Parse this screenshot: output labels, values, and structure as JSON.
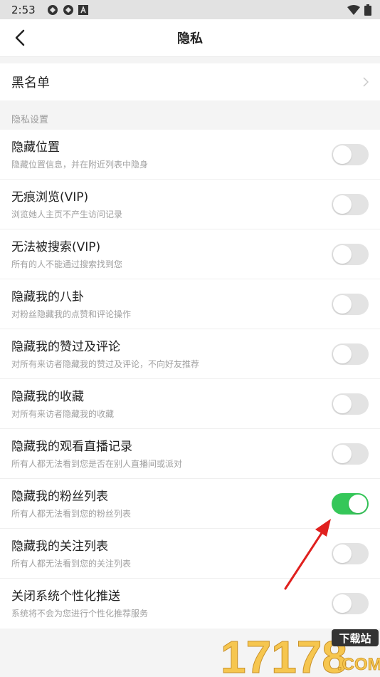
{
  "status": {
    "time": "2:53"
  },
  "nav": {
    "title": "隐私"
  },
  "blacklist": {
    "label": "黑名单"
  },
  "section": {
    "title": "隐私设置"
  },
  "items": [
    {
      "title": "隐藏位置",
      "subtitle": "隐藏位置信息，并在附近列表中隐身",
      "on": false
    },
    {
      "title": "无痕浏览(VIP)",
      "subtitle": "浏览她人主页不产生访问记录",
      "on": false
    },
    {
      "title": "无法被搜索(VIP)",
      "subtitle": "所有的人不能通过搜索找到您",
      "on": false
    },
    {
      "title": "隐藏我的八卦",
      "subtitle": "对粉丝隐藏我的点赞和评论操作",
      "on": false
    },
    {
      "title": "隐藏我的赞过及评论",
      "subtitle": "对所有来访者隐藏我的赞过及评论，不向好友推荐",
      "on": false
    },
    {
      "title": "隐藏我的收藏",
      "subtitle": "对所有来访者隐藏我的收藏",
      "on": false
    },
    {
      "title": "隐藏我的观看直播记录",
      "subtitle": "所有人都无法看到您是否在别人直播间或派对",
      "on": false
    },
    {
      "title": "隐藏我的粉丝列表",
      "subtitle": "所有人都无法看到您的粉丝列表",
      "on": true
    },
    {
      "title": "隐藏我的关注列表",
      "subtitle": "所有人都无法看到您的关注列表",
      "on": false
    },
    {
      "title": "关闭系统个性化推送",
      "subtitle": "系统将不会为您进行个性化推荐服务",
      "on": false
    }
  ],
  "watermark": {
    "number": "17178",
    "tag": "下载站",
    "domain": ".COM"
  },
  "colors": {
    "toggle_on": "#35c759",
    "toggle_off": "#e3e3e3",
    "arrow": "#e0201e"
  }
}
